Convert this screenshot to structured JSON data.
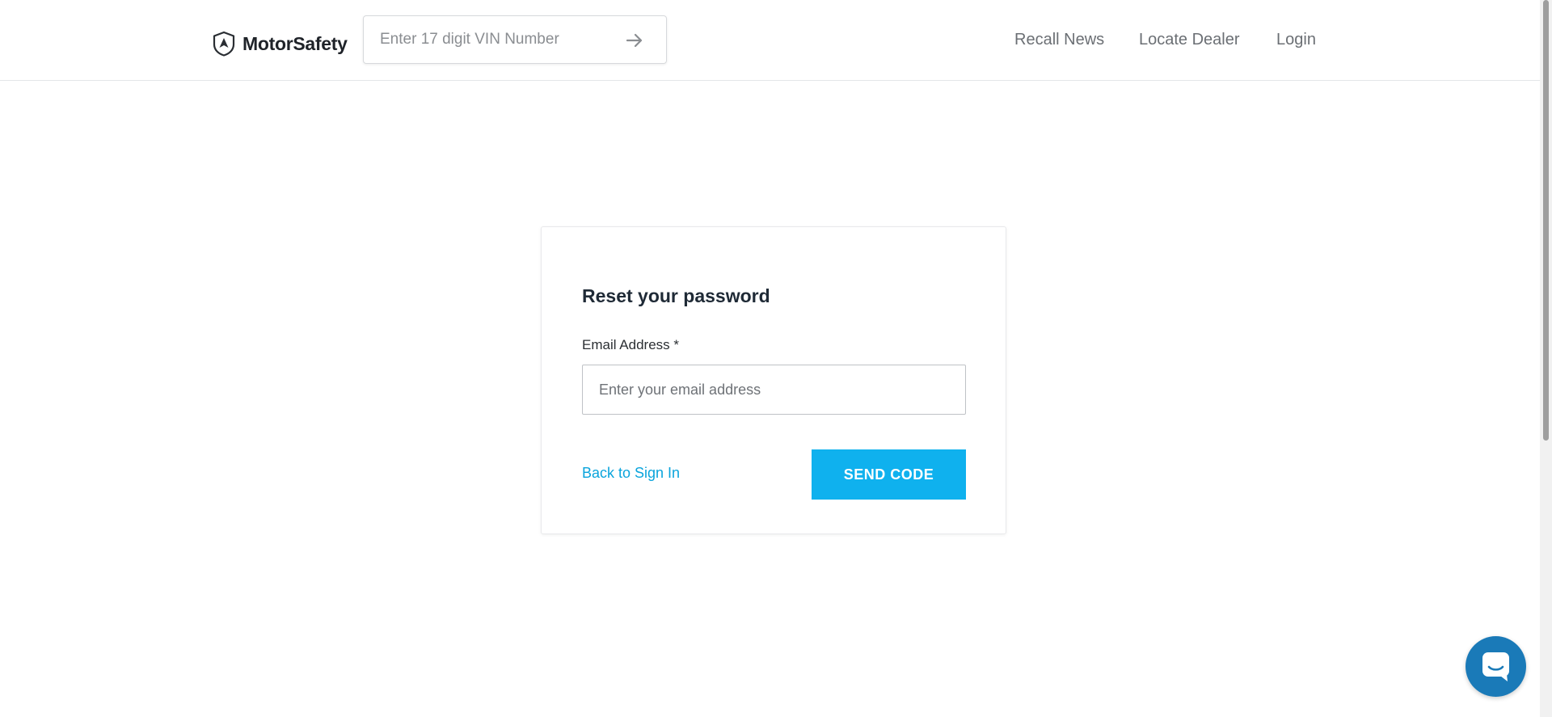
{
  "header": {
    "logo_text": "MotorSafety",
    "vin_placeholder": "Enter 17 digit VIN Number",
    "nav": {
      "recall_news": "Recall News",
      "locate_dealer": "Locate Dealer",
      "login": "Login"
    }
  },
  "reset_form": {
    "title": "Reset your password",
    "email_label": "Email Address *",
    "email_placeholder": "Enter your email address",
    "back_link": "Back to Sign In",
    "send_button": "SEND CODE"
  },
  "colors": {
    "accent": "#0fb1ee",
    "link": "#0aa4dc",
    "chat": "#1a7ab8"
  },
  "icons": {
    "logo": "shield-icon",
    "vin_submit": "arrow-right-icon",
    "chat": "chat-icon"
  }
}
